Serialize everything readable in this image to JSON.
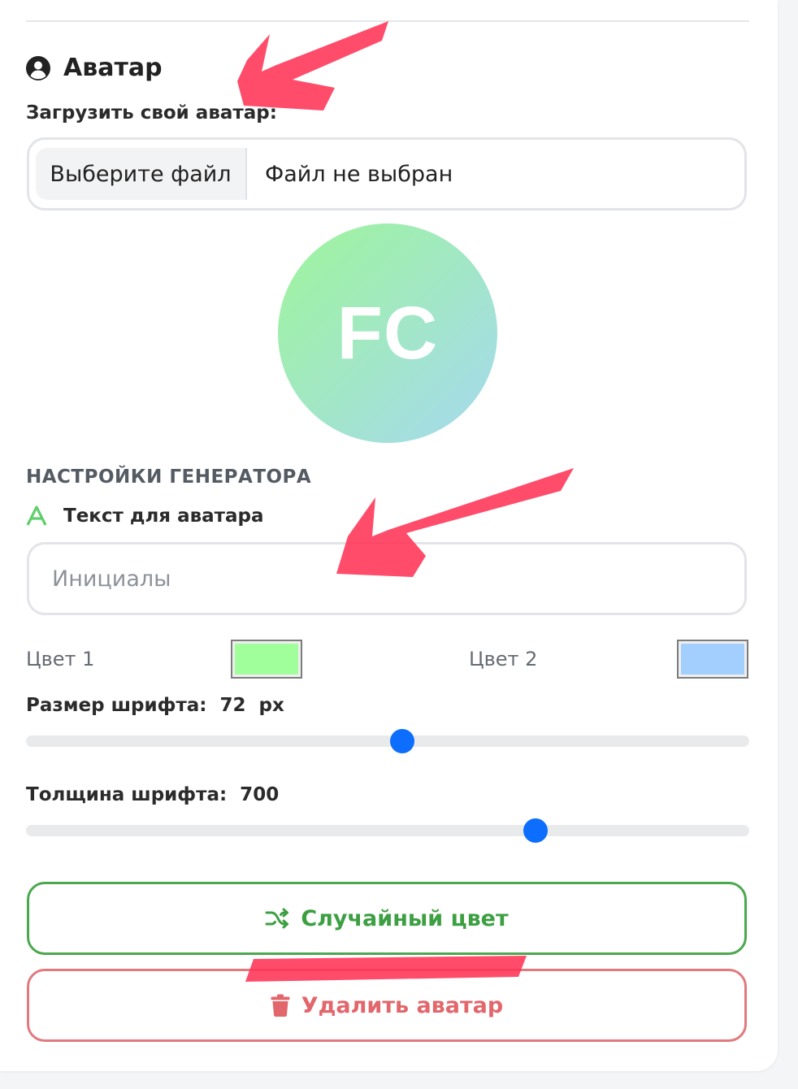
{
  "avatar_section": {
    "title": "Аватар",
    "upload_label": "Загрузить свой аватар:",
    "file_button": "Выберите файл",
    "file_status": "Файл не выбран"
  },
  "preview": {
    "initials": "FC",
    "gradient_start": "#9ef59a",
    "gradient_end": "#a6d9f0"
  },
  "generator": {
    "title": "НАСТРОЙКИ ГЕНЕРАТОРА",
    "text_label": "Текст для аватара",
    "text_placeholder": "Инициалы",
    "text_value": "",
    "color1_label": "Цвет 1",
    "color1_value": "#a0ff9b",
    "color2_label": "Цвет 2",
    "color2_value": "#a2cffe",
    "font_size_label": "Размер шрифта:  72  px",
    "font_size_fraction": 0.52,
    "font_weight_label": "Толщина шрифта:  700",
    "font_weight_fraction": 0.705
  },
  "actions": {
    "random_color": "Случайный цвет",
    "delete_avatar": "Удалить аватар"
  },
  "colors": {
    "accent_blue": "#0d6efd",
    "success_green": "#3c9f42",
    "danger_red": "#e2676c",
    "annotation_red": "#ff3355"
  },
  "icons": {
    "section": "user-circle-icon",
    "text": "letter-a-icon",
    "random": "shuffle-icon",
    "delete": "trash-icon"
  }
}
